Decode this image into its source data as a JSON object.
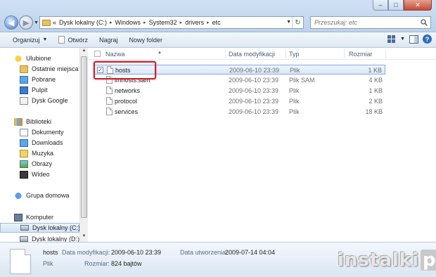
{
  "window": {
    "minimize_label": "‒",
    "maximize_label": "□",
    "close_label": "✕"
  },
  "address": {
    "chevron": "«",
    "crumbs": [
      "Dysk lokalny (C:)",
      "Windows",
      "System32",
      "drivers",
      "etc"
    ],
    "separator": "▸",
    "dropdown": "▼",
    "refresh": "↻"
  },
  "search": {
    "placeholder": "Przeszukaj: etc"
  },
  "toolbar": {
    "organize": "Organizuj",
    "open": "Otwórz",
    "burn": "Nagraj",
    "new_folder": "Nowy folder",
    "dropdown": "▼",
    "help": "?"
  },
  "sidebar": {
    "favorites": "Ulubione",
    "recent": "Ostatnie miejsca",
    "downloads_fav": "Pobrane",
    "desktop": "Pulpit",
    "google_drive": "Dysk Google",
    "libraries": "Biblioteki",
    "documents": "Dokumenty",
    "downloads_lib": "Downloads",
    "music": "Muzyka",
    "pictures": "Obrazy",
    "video": "Wideo",
    "homegroup": "Grupa domowa",
    "computer": "Komputer",
    "drive_c": "Dysk lokalny (C:)",
    "drive_d": "Dysk lokalny (D:)"
  },
  "columns": {
    "name": "Nazwa",
    "date": "Data modyfikacji",
    "type": "Typ",
    "size": "Rozmiar"
  },
  "files": [
    {
      "name": "hosts",
      "date": "2009-06-10 23:39",
      "type": "Plik",
      "size": "1 KB",
      "checked": "✓"
    },
    {
      "name": "lmhosts.sam",
      "date": "2009-06-10 23:39",
      "type": "Plik SAM",
      "size": "4 KB"
    },
    {
      "name": "networks",
      "date": "2009-06-10 23:39",
      "type": "Plik",
      "size": "1 KB"
    },
    {
      "name": "protocol",
      "date": "2009-06-10 23:39",
      "type": "Plik",
      "size": "2 KB"
    },
    {
      "name": "services",
      "date": "2009-06-10 23:39",
      "type": "Plik",
      "size": "18 KB"
    }
  ],
  "details": {
    "name": "hosts",
    "modified_label": "Data modyfikacji:",
    "modified": "2009-06-10 23:39",
    "created_label": "Data utworzenia:",
    "created": "2009-07-14 04:04",
    "type": "Plik",
    "size_label": "Rozmiar:",
    "size": "824 bajtów"
  },
  "watermark": {
    "text": "instalki",
    "suffix": "pl"
  }
}
